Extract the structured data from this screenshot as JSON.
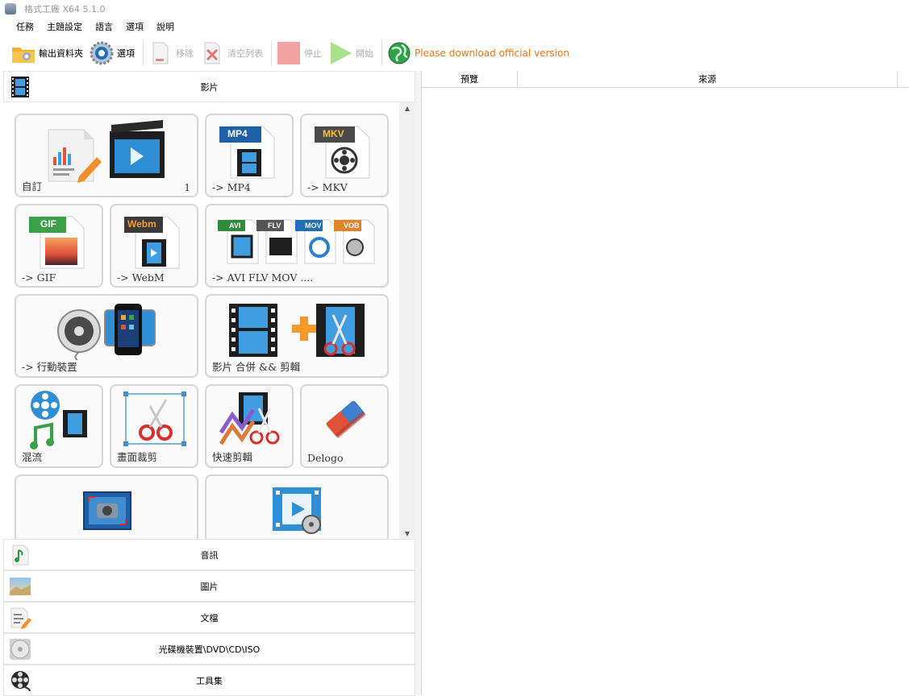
{
  "window": {
    "title": "格式工廠 X64 5.1.0"
  },
  "menu": [
    "任務",
    "主題設定",
    "語言",
    "選項",
    "說明"
  ],
  "toolbar": {
    "output_folder": "輸出資料夾",
    "options": "選項",
    "remove": "移除",
    "clear_list": "清空列表",
    "stop": "停止",
    "start": "開始",
    "download_notice": "Please download official version"
  },
  "categories": {
    "video": "影片",
    "audio": "音訊",
    "image": "圖片",
    "document": "文檔",
    "disc": "光碟機裝置\\DVD\\CD\\ISO",
    "tools": "工具集"
  },
  "tiles": {
    "custom": {
      "label": "自訂",
      "count": "1"
    },
    "mp4": {
      "label": "-> MP4",
      "badge": "MP4"
    },
    "mkv": {
      "label": "-> MKV",
      "badge": "MKV"
    },
    "gif": {
      "label": "-> GIF",
      "badge": "GIF"
    },
    "webm": {
      "label": "-> WebM",
      "badge": "Webm"
    },
    "avi_flv_mov": {
      "label": "-> AVI FLV MOV ....",
      "badges": [
        "AVI",
        "FLV",
        "MOV",
        "VOB"
      ]
    },
    "mobile": {
      "label": "-> 行動裝置"
    },
    "merge_cut": {
      "label": "影片 合併 && 剪輯"
    },
    "mux": {
      "label": "混流"
    },
    "crop": {
      "label": "畫面裁剪"
    },
    "quick_cut": {
      "label": "快速剪輯"
    },
    "delogo": {
      "label": "Delogo"
    }
  },
  "table": {
    "columns": [
      "預覽",
      "來源"
    ]
  },
  "colors": {
    "accent_orange": "#e8751a",
    "tile_border": "#d6d6d6",
    "film_blue": "#2f8fd6"
  }
}
